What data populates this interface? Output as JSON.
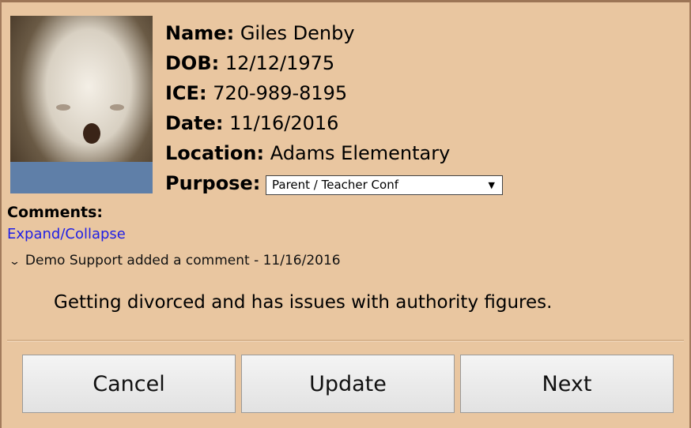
{
  "profile": {
    "name_label": "Name:",
    "name": "Giles Denby",
    "dob_label": "DOB:",
    "dob": "12/12/1975",
    "ice_label": "ICE:",
    "ice": "720-989-8195",
    "date_label": "Date:",
    "date": "11/16/2016",
    "location_label": "Location:",
    "location": "Adams Elementary",
    "purpose_label": "Purpose:",
    "purpose_selected": "Parent / Teacher Conf"
  },
  "comments": {
    "title": "Comments:",
    "expand_link": "Expand/Collapse",
    "entries": [
      {
        "header": "Demo Support added a comment - 11/16/2016",
        "body": "Getting divorced and has issues with authority figures."
      }
    ]
  },
  "icons": {
    "dropdown": "chevron-down-icon",
    "comment_toggle": "chevron-down-icon"
  },
  "buttons": {
    "cancel": "Cancel",
    "update": "Update",
    "next": "Next"
  },
  "colors": {
    "background": "#e9c6a0",
    "link": "#1f1fe6",
    "button_bg": "#eaeaea"
  }
}
